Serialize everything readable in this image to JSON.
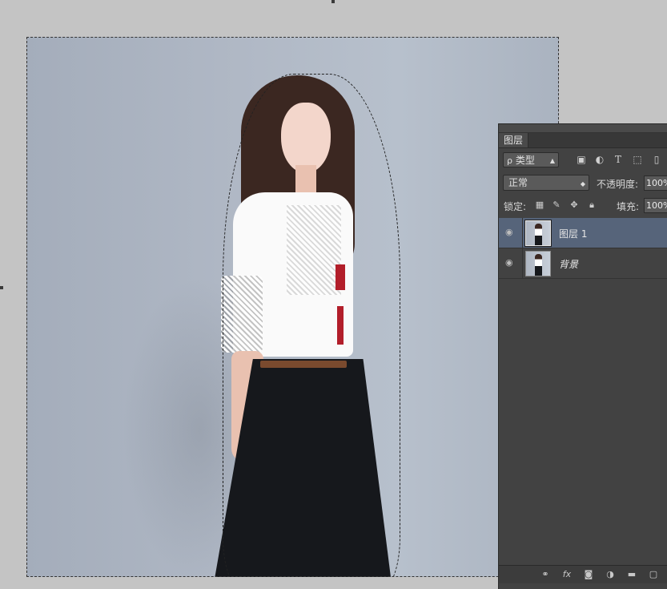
{
  "layers_panel": {
    "tab_label": "图层",
    "filter": {
      "selected": "类型",
      "search_icon": "ρ"
    },
    "filter_icons": [
      "image-filter-icon",
      "adjustment-filter-icon",
      "type-filter-icon",
      "shape-filter-icon",
      "smart-object-filter-icon"
    ],
    "blend_mode": {
      "selected": "正常"
    },
    "opacity": {
      "label": "不透明度:",
      "value": "100%"
    },
    "lock": {
      "label": "锁定:"
    },
    "fill": {
      "label": "填充:",
      "value": "100%"
    },
    "layers": [
      {
        "name": "图层 1",
        "visible": true,
        "active": true
      },
      {
        "name": "背景",
        "visible": true,
        "active": false
      }
    ],
    "footer_icons": [
      "link-icon",
      "fx-icon",
      "mask-icon",
      "adjustment-icon",
      "folder-icon",
      "new-layer-icon"
    ]
  },
  "colors": {
    "workspace_bg": "#c4c4c4",
    "panel_bg": "#424242",
    "active_layer": "#56647a"
  }
}
